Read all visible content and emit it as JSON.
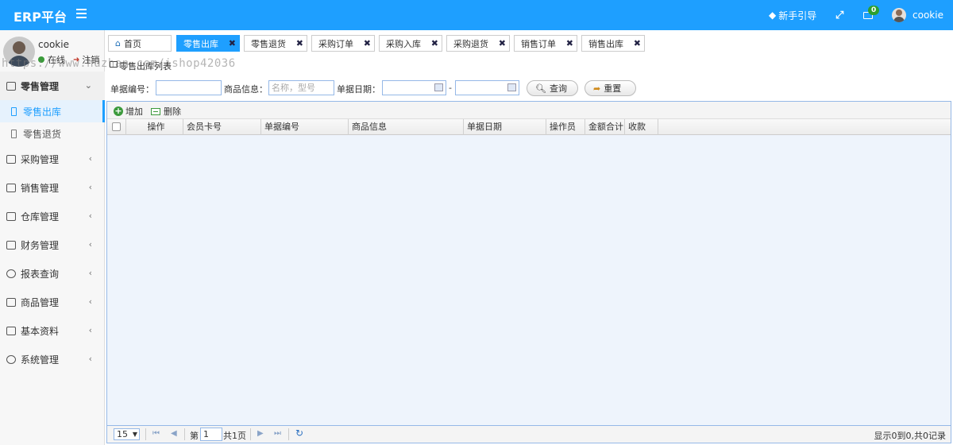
{
  "app": {
    "title": "ERP平台"
  },
  "header": {
    "guide_label": "新手引导",
    "mail_badge": "0",
    "user_name": "cookie"
  },
  "sidebar": {
    "user": {
      "name": "cookie",
      "status": "在线",
      "logout": "注销"
    },
    "menu": [
      {
        "label": "零售管理",
        "open": true,
        "children": [
          {
            "label": "零售出库",
            "active": true
          },
          {
            "label": "零售退货",
            "active": false
          }
        ]
      },
      {
        "label": "采购管理"
      },
      {
        "label": "销售管理"
      },
      {
        "label": "仓库管理"
      },
      {
        "label": "财务管理"
      },
      {
        "label": "报表查询"
      },
      {
        "label": "商品管理"
      },
      {
        "label": "基本资料"
      },
      {
        "label": "系统管理"
      }
    ]
  },
  "tabs": [
    {
      "label": "首页"
    },
    {
      "label": "零售出库"
    },
    {
      "label": "零售退货"
    },
    {
      "label": "采购订单"
    },
    {
      "label": "采购入库"
    },
    {
      "label": "采购退货"
    },
    {
      "label": "销售订单"
    },
    {
      "label": "销售出库"
    }
  ],
  "breadcrumb": "零售出库列表",
  "watermark": "https://www.huzhan.com/ishop42036",
  "search": {
    "order_no_label": "单据编号：",
    "goods_label": "商品信息：",
    "goods_placeholder": "名称，型号",
    "date_label": "单据日期：",
    "date_sep": "-",
    "query_button": "查询",
    "reset_button": "重置"
  },
  "toolbar": {
    "add": "增加",
    "delete": "删除"
  },
  "table": {
    "columns": [
      "操作",
      "会员卡号",
      "单据编号",
      "商品信息",
      "单据日期",
      "操作员",
      "金额合计",
      "收款"
    ]
  },
  "pager": {
    "page_size": "15",
    "page_prefix": "第",
    "page_no": "1",
    "page_total": "共1页",
    "summary": "显示0到0,共0记录"
  }
}
